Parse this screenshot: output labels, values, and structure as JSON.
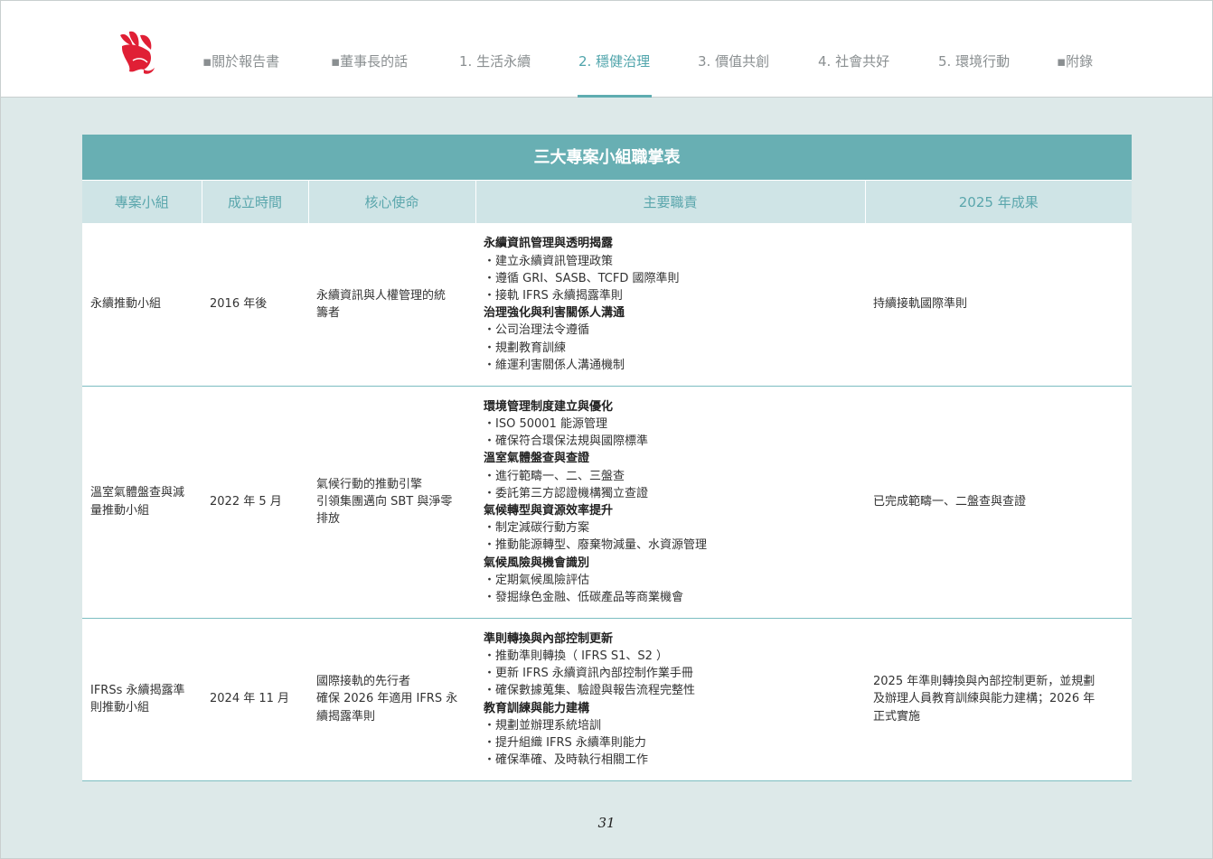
{
  "brand": {
    "logo_color": "#e01f35"
  },
  "nav": {
    "items": [
      {
        "label": "▪關於報告書",
        "active": false
      },
      {
        "label": "▪董事長的話",
        "active": false
      },
      {
        "label": "1. 生活永續",
        "active": false
      },
      {
        "label": "2. 穩健治理",
        "active": true
      },
      {
        "label": "3. 價值共創",
        "active": false
      },
      {
        "label": "4. 社會共好",
        "active": false
      },
      {
        "label": "5. 環境行動",
        "active": false
      },
      {
        "label": "▪附錄",
        "active": false
      }
    ]
  },
  "table": {
    "title": "三大專案小組職掌表",
    "columns": [
      "專案小組",
      "成立時間",
      "核心使命",
      "主要職責",
      "2025 年成果"
    ],
    "rows": [
      {
        "group": "永續推動小組",
        "established": "2016 年後",
        "mission": [
          "永續資訊與人權管理的統",
          "籌者"
        ],
        "duties": [
          {
            "text": "永續資訊管理與透明揭露",
            "heading": true
          },
          {
            "text": "・建立永續資訊管理政策",
            "heading": false
          },
          {
            "text": "・遵循 GRI、SASB、TCFD 國際準則",
            "heading": false
          },
          {
            "text": "・接軌 IFRS 永續揭露準則",
            "heading": false
          },
          {
            "text": "治理強化與利害關係人溝通",
            "heading": true
          },
          {
            "text": "・公司治理法令遵循",
            "heading": false
          },
          {
            "text": "・規劃教育訓練",
            "heading": false
          },
          {
            "text": "・維運利害關係人溝通機制",
            "heading": false
          }
        ],
        "result": [
          "持續接軌國際準則"
        ]
      },
      {
        "group": "溫室氣體盤查與減量推動小組",
        "established": "2022 年 5 月",
        "mission": [
          "氣候行動的推動引擎",
          "引領集團邁向 SBT 與淨零",
          "排放"
        ],
        "duties": [
          {
            "text": "環境管理制度建立與優化",
            "heading": true
          },
          {
            "text": "・ISO 50001 能源管理",
            "heading": false
          },
          {
            "text": "・確保符合環保法規與國際標準",
            "heading": false
          },
          {
            "text": "溫室氣體盤查與查證",
            "heading": true
          },
          {
            "text": "・進行範疇一、二、三盤查",
            "heading": false
          },
          {
            "text": "・委託第三方認證機構獨立查證",
            "heading": false
          },
          {
            "text": "氣候轉型與資源效率提升",
            "heading": true
          },
          {
            "text": "・制定減碳行動方案",
            "heading": false
          },
          {
            "text": "・推動能源轉型、廢棄物減量、水資源管理",
            "heading": false
          },
          {
            "text": "氣候風險與機會識別",
            "heading": true
          },
          {
            "text": "・定期氣候風險評估",
            "heading": false
          },
          {
            "text": "・發掘綠色金融、低碳產品等商業機會",
            "heading": false
          }
        ],
        "result": [
          "已完成範疇一、二盤查與查證"
        ]
      },
      {
        "group": "IFRSs 永續揭露準則推動小組",
        "established": "2024 年 11 月",
        "mission": [
          "國際接軌的先行者",
          "確保 2026 年適用 IFRS 永",
          "續揭露準則"
        ],
        "duties": [
          {
            "text": "準則轉換與內部控制更新",
            "heading": true
          },
          {
            "text": "・推動準則轉換（ IFRS S1、S2 ）",
            "heading": false
          },
          {
            "text": "・更新 IFRS 永續資訊內部控制作業手冊",
            "heading": false
          },
          {
            "text": "・確保數據蒐集、驗證與報告流程完整性",
            "heading": false
          },
          {
            "text": "教育訓練與能力建構",
            "heading": true
          },
          {
            "text": "・規劃並辦理系統培訓",
            "heading": false
          },
          {
            "text": "・提升組織 IFRS 永續準則能力",
            "heading": false
          },
          {
            "text": "・確保準確、及時執行相關工作",
            "heading": false
          }
        ],
        "result": [
          "2025 年準則轉換與內部控制更新，並規劃",
          "及辦理人員教育訓練與能力建構；2026 年",
          "正式實施"
        ]
      }
    ]
  },
  "page_number": "31"
}
